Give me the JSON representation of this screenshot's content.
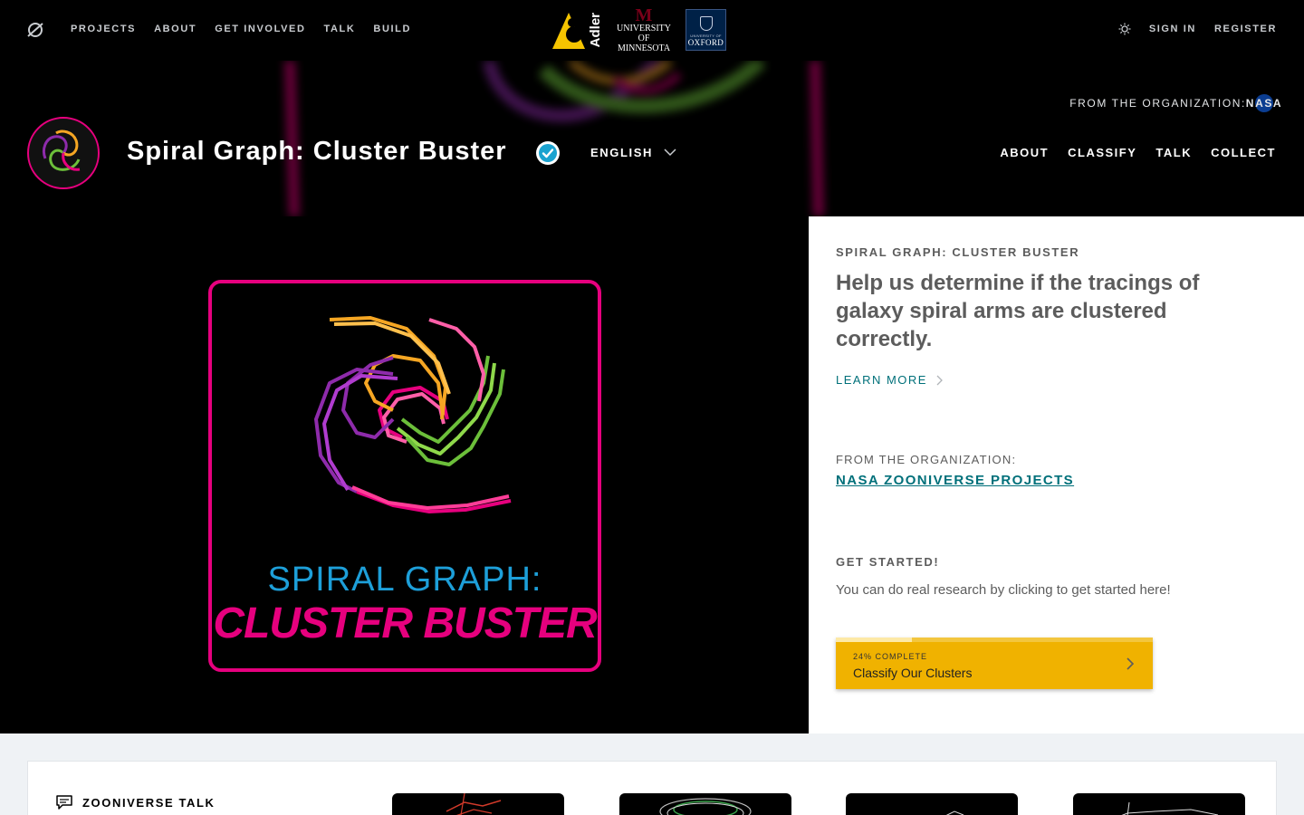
{
  "topnav": {
    "links": [
      "PROJECTS",
      "ABOUT",
      "GET INVOLVED",
      "TALK",
      "BUILD"
    ],
    "partners": {
      "adler": "Adler",
      "umn_line1": "UNIVERSITY",
      "umn_line2": "OF MINNESOTA",
      "oxford_small": "UNIVERSITY OF",
      "oxford_big": "OXFORD"
    },
    "sign_in": "SIGN IN",
    "register": "REGISTER"
  },
  "project_header": {
    "from_org": "FROM THE ORGANIZATION:",
    "org_badge": "NASA",
    "title": "Spiral Graph: Cluster Buster",
    "language": "ENGLISH",
    "nav": [
      "ABOUT",
      "CLASSIFY",
      "TALK",
      "COLLECT"
    ]
  },
  "hero": {
    "art_line1": "SPIRAL GRAPH:",
    "art_line2": "CLUSTER BUSTER",
    "eyebrow": "SPIRAL GRAPH: CLUSTER BUSTER",
    "description": "Help us determine if the tracings of galaxy spiral arms are clustered correctly.",
    "learn_more": "LEARN MORE",
    "org_label": "FROM THE ORGANIZATION:",
    "org_link": "NASA ZOONIVERSE PROJECTS",
    "get_started_label": "GET STARTED!",
    "get_started_text": "You can do real research by clicking to get started here!",
    "workflow": {
      "progress_text": "24% COMPLETE",
      "progress": 0.24,
      "label": "Classify Our Clusters"
    }
  },
  "talk": {
    "title": "ZOONIVERSE TALK"
  },
  "colors": {
    "accent_teal": "#00707a",
    "workflow_gold": "#f0b200",
    "brand_magenta": "#e6007e"
  }
}
